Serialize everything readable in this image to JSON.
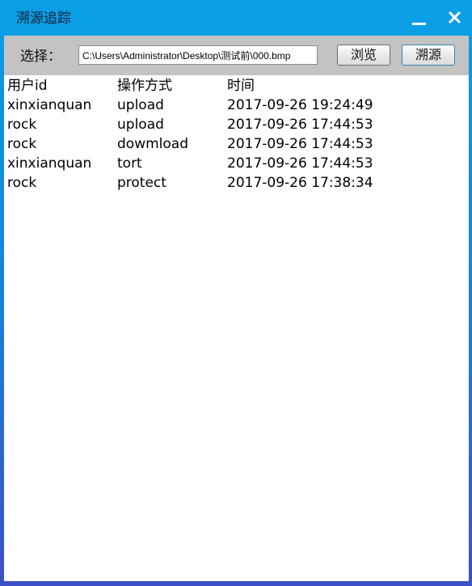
{
  "window": {
    "title": "溯源追踪",
    "colors": {
      "title_bar": "#0a9ee6",
      "toolbar": "#c3c3c3",
      "content": "#ffffff"
    }
  },
  "titlebar_controls": {
    "minimize_icon": "minimize-icon",
    "close_icon": "close-icon"
  },
  "toolbar": {
    "select_label": "选择：",
    "path_value": "C:\\Users\\Administrator\\Desktop\\测试前\\000.bmp",
    "browse_label": "浏览",
    "trace_label": "溯源"
  },
  "table": {
    "headers": [
      "用户id",
      "操作方式",
      "时间"
    ],
    "rows": [
      [
        "xinxianquan",
        "upload",
        "2017-09-26 19:24:49"
      ],
      [
        "rock",
        "upload",
        "2017-09-26 17:44:53"
      ],
      [
        "rock",
        "dowmload",
        "2017-09-26 17:44:53"
      ],
      [
        "xinxianquan",
        "tort",
        "2017-09-26 17:44:53"
      ],
      [
        "rock",
        "protect",
        "2017-09-26 17:38:34"
      ]
    ]
  }
}
